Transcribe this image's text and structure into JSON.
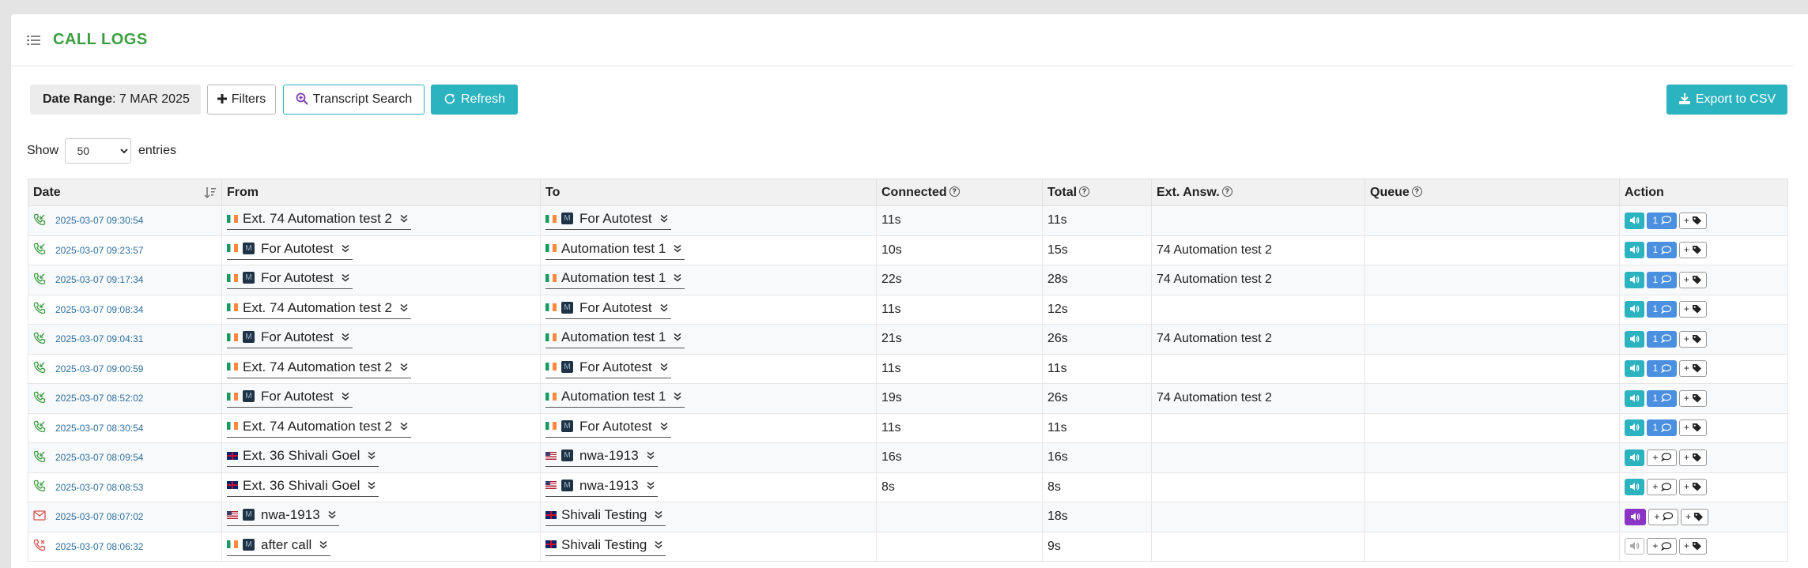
{
  "header": {
    "title": "CALL LOGS",
    "icon": "list-icon"
  },
  "toolbar": {
    "date_range_label": "Date Range",
    "date_range_value": "7 MAR 2025",
    "filters_label": "Filters",
    "transcript_label": "Transcript Search",
    "refresh_label": "Refresh",
    "export_label": "Export to CSV"
  },
  "entries": {
    "show_label": "Show",
    "value": "50",
    "entries_label": "entries"
  },
  "columns": {
    "date": "Date",
    "from": "From",
    "to": "To",
    "connected": "Connected",
    "total": "Total",
    "ext_answ": "Ext. Answ.",
    "queue": "Queue",
    "action": "Action"
  },
  "colors": {
    "accent_green": "#3c9e41",
    "teal": "#2bb3c0",
    "blue": "#4a8fe0",
    "purple": "#8a34c6",
    "missed_red": "#d9534f"
  },
  "rows": [
    {
      "status": "answered",
      "date": "2025-03-07 09:30:54",
      "from": {
        "flag": "ie",
        "m": false,
        "name": "Ext. 74 Automation test 2"
      },
      "to": {
        "flag": "ie",
        "m": true,
        "name": "For Autotest"
      },
      "connected": "11s",
      "total": "11s",
      "ext": "",
      "queue": "",
      "play": "teal",
      "comments": "1"
    },
    {
      "status": "answered",
      "date": "2025-03-07 09:23:57",
      "from": {
        "flag": "ie",
        "m": true,
        "name": "For Autotest"
      },
      "to": {
        "flag": "ie",
        "m": false,
        "name": "Automation test 1"
      },
      "connected": "10s",
      "total": "15s",
      "ext": "74 Automation test 2",
      "queue": "",
      "play": "teal",
      "comments": "1"
    },
    {
      "status": "answered",
      "date": "2025-03-07 09:17:34",
      "from": {
        "flag": "ie",
        "m": true,
        "name": "For Autotest"
      },
      "to": {
        "flag": "ie",
        "m": false,
        "name": "Automation test 1"
      },
      "connected": "22s",
      "total": "28s",
      "ext": "74 Automation test 2",
      "queue": "",
      "play": "teal",
      "comments": "1"
    },
    {
      "status": "answered",
      "date": "2025-03-07 09:08:34",
      "from": {
        "flag": "ie",
        "m": false,
        "name": "Ext. 74 Automation test 2"
      },
      "to": {
        "flag": "ie",
        "m": true,
        "name": "For Autotest"
      },
      "connected": "11s",
      "total": "12s",
      "ext": "",
      "queue": "",
      "play": "teal",
      "comments": "1"
    },
    {
      "status": "answered",
      "date": "2025-03-07 09:04:31",
      "from": {
        "flag": "ie",
        "m": true,
        "name": "For Autotest"
      },
      "to": {
        "flag": "ie",
        "m": false,
        "name": "Automation test 1"
      },
      "connected": "21s",
      "total": "26s",
      "ext": "74 Automation test 2",
      "queue": "",
      "play": "teal",
      "comments": "1"
    },
    {
      "status": "answered",
      "date": "2025-03-07 09:00:59",
      "from": {
        "flag": "ie",
        "m": false,
        "name": "Ext. 74 Automation test 2"
      },
      "to": {
        "flag": "ie",
        "m": true,
        "name": "For Autotest"
      },
      "connected": "11s",
      "total": "11s",
      "ext": "",
      "queue": "",
      "play": "teal",
      "comments": "1"
    },
    {
      "status": "answered",
      "date": "2025-03-07 08:52:02",
      "from": {
        "flag": "ie",
        "m": true,
        "name": "For Autotest"
      },
      "to": {
        "flag": "ie",
        "m": false,
        "name": "Automation test 1"
      },
      "connected": "19s",
      "total": "26s",
      "ext": "74 Automation test 2",
      "queue": "",
      "play": "teal",
      "comments": "1"
    },
    {
      "status": "answered",
      "date": "2025-03-07 08:30:54",
      "from": {
        "flag": "ie",
        "m": false,
        "name": "Ext. 74 Automation test 2"
      },
      "to": {
        "flag": "ie",
        "m": true,
        "name": "For Autotest"
      },
      "connected": "11s",
      "total": "11s",
      "ext": "",
      "queue": "",
      "play": "teal",
      "comments": "1"
    },
    {
      "status": "answered",
      "date": "2025-03-07 08:09:54",
      "from": {
        "flag": "uk",
        "m": false,
        "name": "Ext. 36 Shivali Goel"
      },
      "to": {
        "flag": "us",
        "m": true,
        "name": "nwa-1913"
      },
      "connected": "16s",
      "total": "16s",
      "ext": "",
      "queue": "",
      "play": "teal",
      "comments": "+"
    },
    {
      "status": "answered",
      "date": "2025-03-07 08:08:53",
      "from": {
        "flag": "uk",
        "m": false,
        "name": "Ext. 36 Shivali Goel"
      },
      "to": {
        "flag": "us",
        "m": true,
        "name": "nwa-1913"
      },
      "connected": "8s",
      "total": "8s",
      "ext": "",
      "queue": "",
      "play": "teal",
      "comments": "+"
    },
    {
      "status": "voicemail",
      "date": "2025-03-07 08:07:02",
      "from": {
        "flag": "us",
        "m": true,
        "name": "nwa-1913"
      },
      "to": {
        "flag": "uk",
        "m": false,
        "name": "Shivali Testing"
      },
      "connected": "",
      "total": "18s",
      "ext": "",
      "queue": "",
      "play": "purple",
      "comments": "+"
    },
    {
      "status": "missed",
      "date": "2025-03-07 08:06:32",
      "from": {
        "flag": "ie",
        "m": true,
        "name": "after call"
      },
      "to": {
        "flag": "uk",
        "m": false,
        "name": "Shivali Testing"
      },
      "connected": "",
      "total": "9s",
      "ext": "",
      "queue": "",
      "play": "light",
      "comments": "+"
    }
  ]
}
